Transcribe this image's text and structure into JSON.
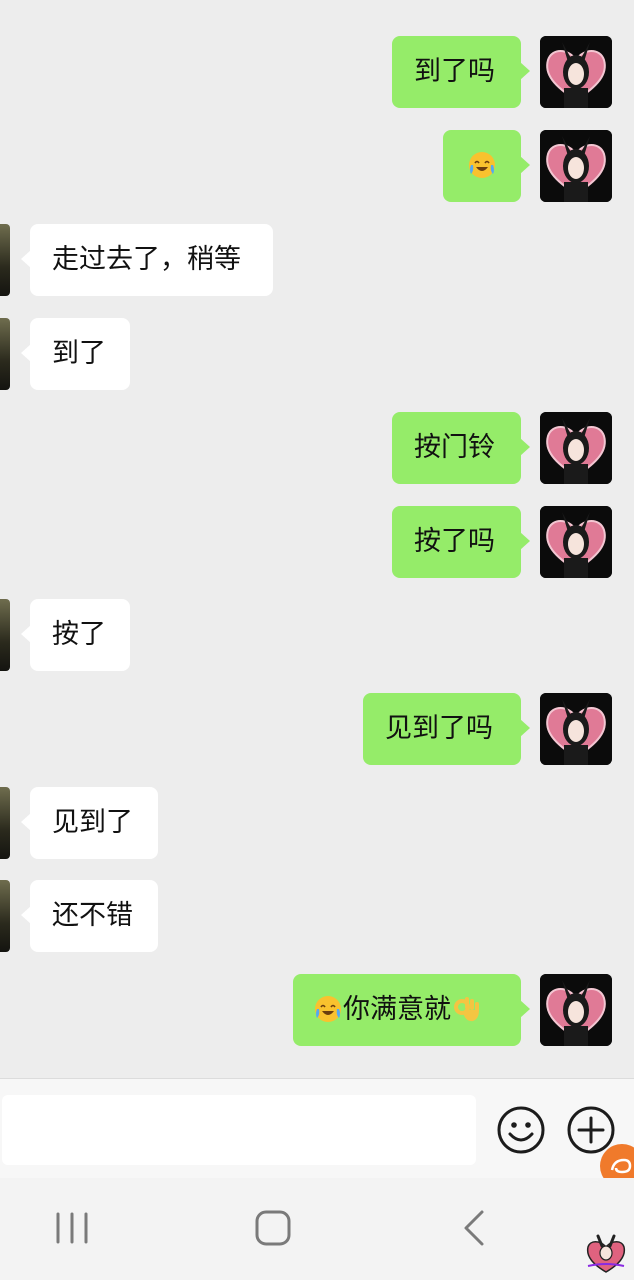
{
  "chat": {
    "messages": [
      {
        "side": "me",
        "text": "到了吗"
      },
      {
        "side": "me",
        "emoji": "crying-laughing-face"
      },
      {
        "side": "them",
        "text": "走过去了，稍等"
      },
      {
        "side": "them",
        "text": "到了"
      },
      {
        "side": "me",
        "text": "按门铃"
      },
      {
        "side": "me",
        "text": "按了吗"
      },
      {
        "side": "them",
        "text": "按了"
      },
      {
        "side": "me",
        "text": "见到了吗"
      },
      {
        "side": "them",
        "text": "见到了"
      },
      {
        "side": "them",
        "text": "还不错"
      },
      {
        "side": "me",
        "emoji_before": "crying-laughing-face",
        "text": "你满意就",
        "emoji_after": "ok-hand"
      }
    ]
  },
  "input_bar": {
    "message_value": "",
    "emoji_button_icon": "smiley-face-icon",
    "plus_button_icon": "plus-circle-icon"
  },
  "nav_bar": {
    "recent_icon": "recent-apps-icon",
    "home_icon": "home-icon",
    "back_icon": "back-icon"
  },
  "colors": {
    "background": "#ededed",
    "my_bubble": "#95ec69",
    "their_bubble": "#ffffff",
    "badge": "#f07a2b"
  }
}
